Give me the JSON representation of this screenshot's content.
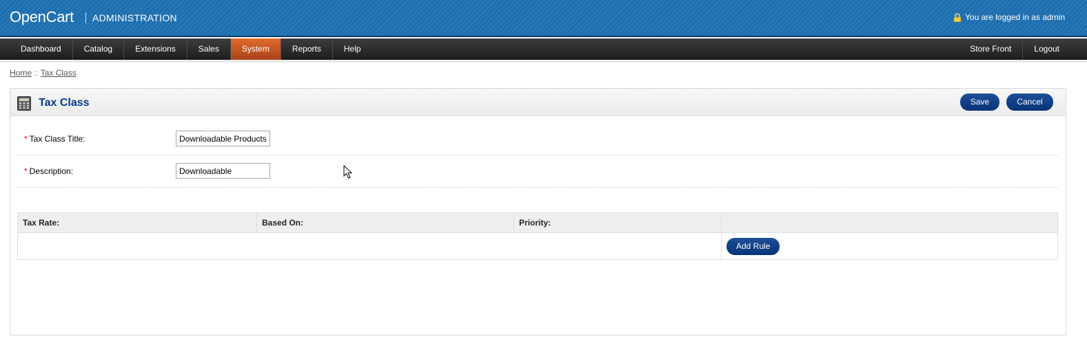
{
  "header": {
    "logo": "OpenCart",
    "subtitle": "ADMINISTRATION",
    "login_info": "You are logged in as admin"
  },
  "menu": {
    "left_items": [
      "Dashboard",
      "Catalog",
      "Extensions",
      "Sales",
      "System",
      "Reports",
      "Help"
    ],
    "active": "System",
    "right_items": [
      "Store Front",
      "Logout"
    ]
  },
  "breadcrumb": {
    "home": "Home",
    "separator": "::",
    "current": "Tax Class"
  },
  "page": {
    "title": "Tax Class",
    "save_label": "Save",
    "cancel_label": "Cancel"
  },
  "form": {
    "required_mark": "*",
    "title_label": "Tax Class Title:",
    "title_value": "Downloadable Products",
    "description_label": "Description:",
    "description_value": "Downloadable"
  },
  "rules_table": {
    "headers": [
      "Tax Rate:",
      "Based On:",
      "Priority:",
      ""
    ],
    "add_rule_label": "Add Rule"
  },
  "colors": {
    "header_blue": "#2577b8",
    "menu_active": "#e16a2a",
    "title_blue": "#003a88",
    "button_blue": "#073377"
  },
  "icons": {
    "lock": "lock-icon",
    "calculator": "calculator-icon",
    "cursor": "mouse-pointer-icon"
  }
}
